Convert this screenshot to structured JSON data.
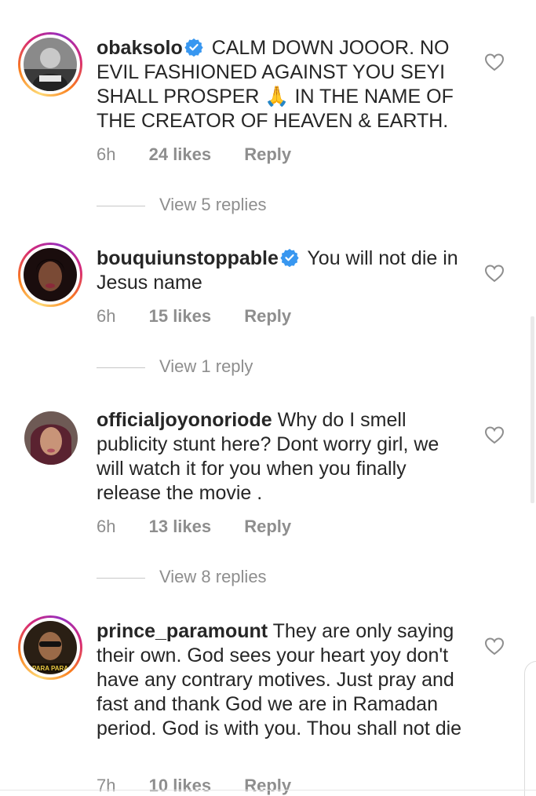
{
  "comments": [
    {
      "username": "obaksolo",
      "verified": true,
      "text": " CALM DOWN JOOOR. NO EVIL FASHIONED AGAINST YOU SEYI SHALL PROSPER 🙏 IN THE NAME OF THE CREATOR OF HEAVEN & EARTH.",
      "time": "6h",
      "likes": "24 likes",
      "reply": "Reply",
      "view_replies": "View 5 replies",
      "story_ring": true
    },
    {
      "username": "bouquiunstoppable",
      "verified": true,
      "text": " You will not die in Jesus name",
      "time": "6h",
      "likes": "15 likes",
      "reply": "Reply",
      "view_replies": "View 1 reply",
      "story_ring": true
    },
    {
      "username": "officialjoyonoriode",
      "verified": false,
      "text": " Why do I smell publicity stunt here? Dont worry girl, we will watch it for you when you finally release the movie .",
      "time": "6h",
      "likes": "13 likes",
      "reply": "Reply",
      "view_replies": "View 8 replies",
      "story_ring": false
    },
    {
      "username": "prince_paramount",
      "verified": false,
      "text": " They are only saying their own. God sees your heart yoy don't have any contrary motives. Just pray and fast and thank God we are in Ramadan period. God is with you. Thou shall not die",
      "time": "7h",
      "likes": "10 likes",
      "reply": "Reply",
      "story_ring": true,
      "avatar_caption": "PARA PARA"
    }
  ],
  "icons": {
    "like": "heart-outline-icon",
    "verified": "verified-badge-icon"
  },
  "colors": {
    "text": "#262626",
    "secondary": "#8e8e8e",
    "verified_blue": "#3897f0"
  }
}
